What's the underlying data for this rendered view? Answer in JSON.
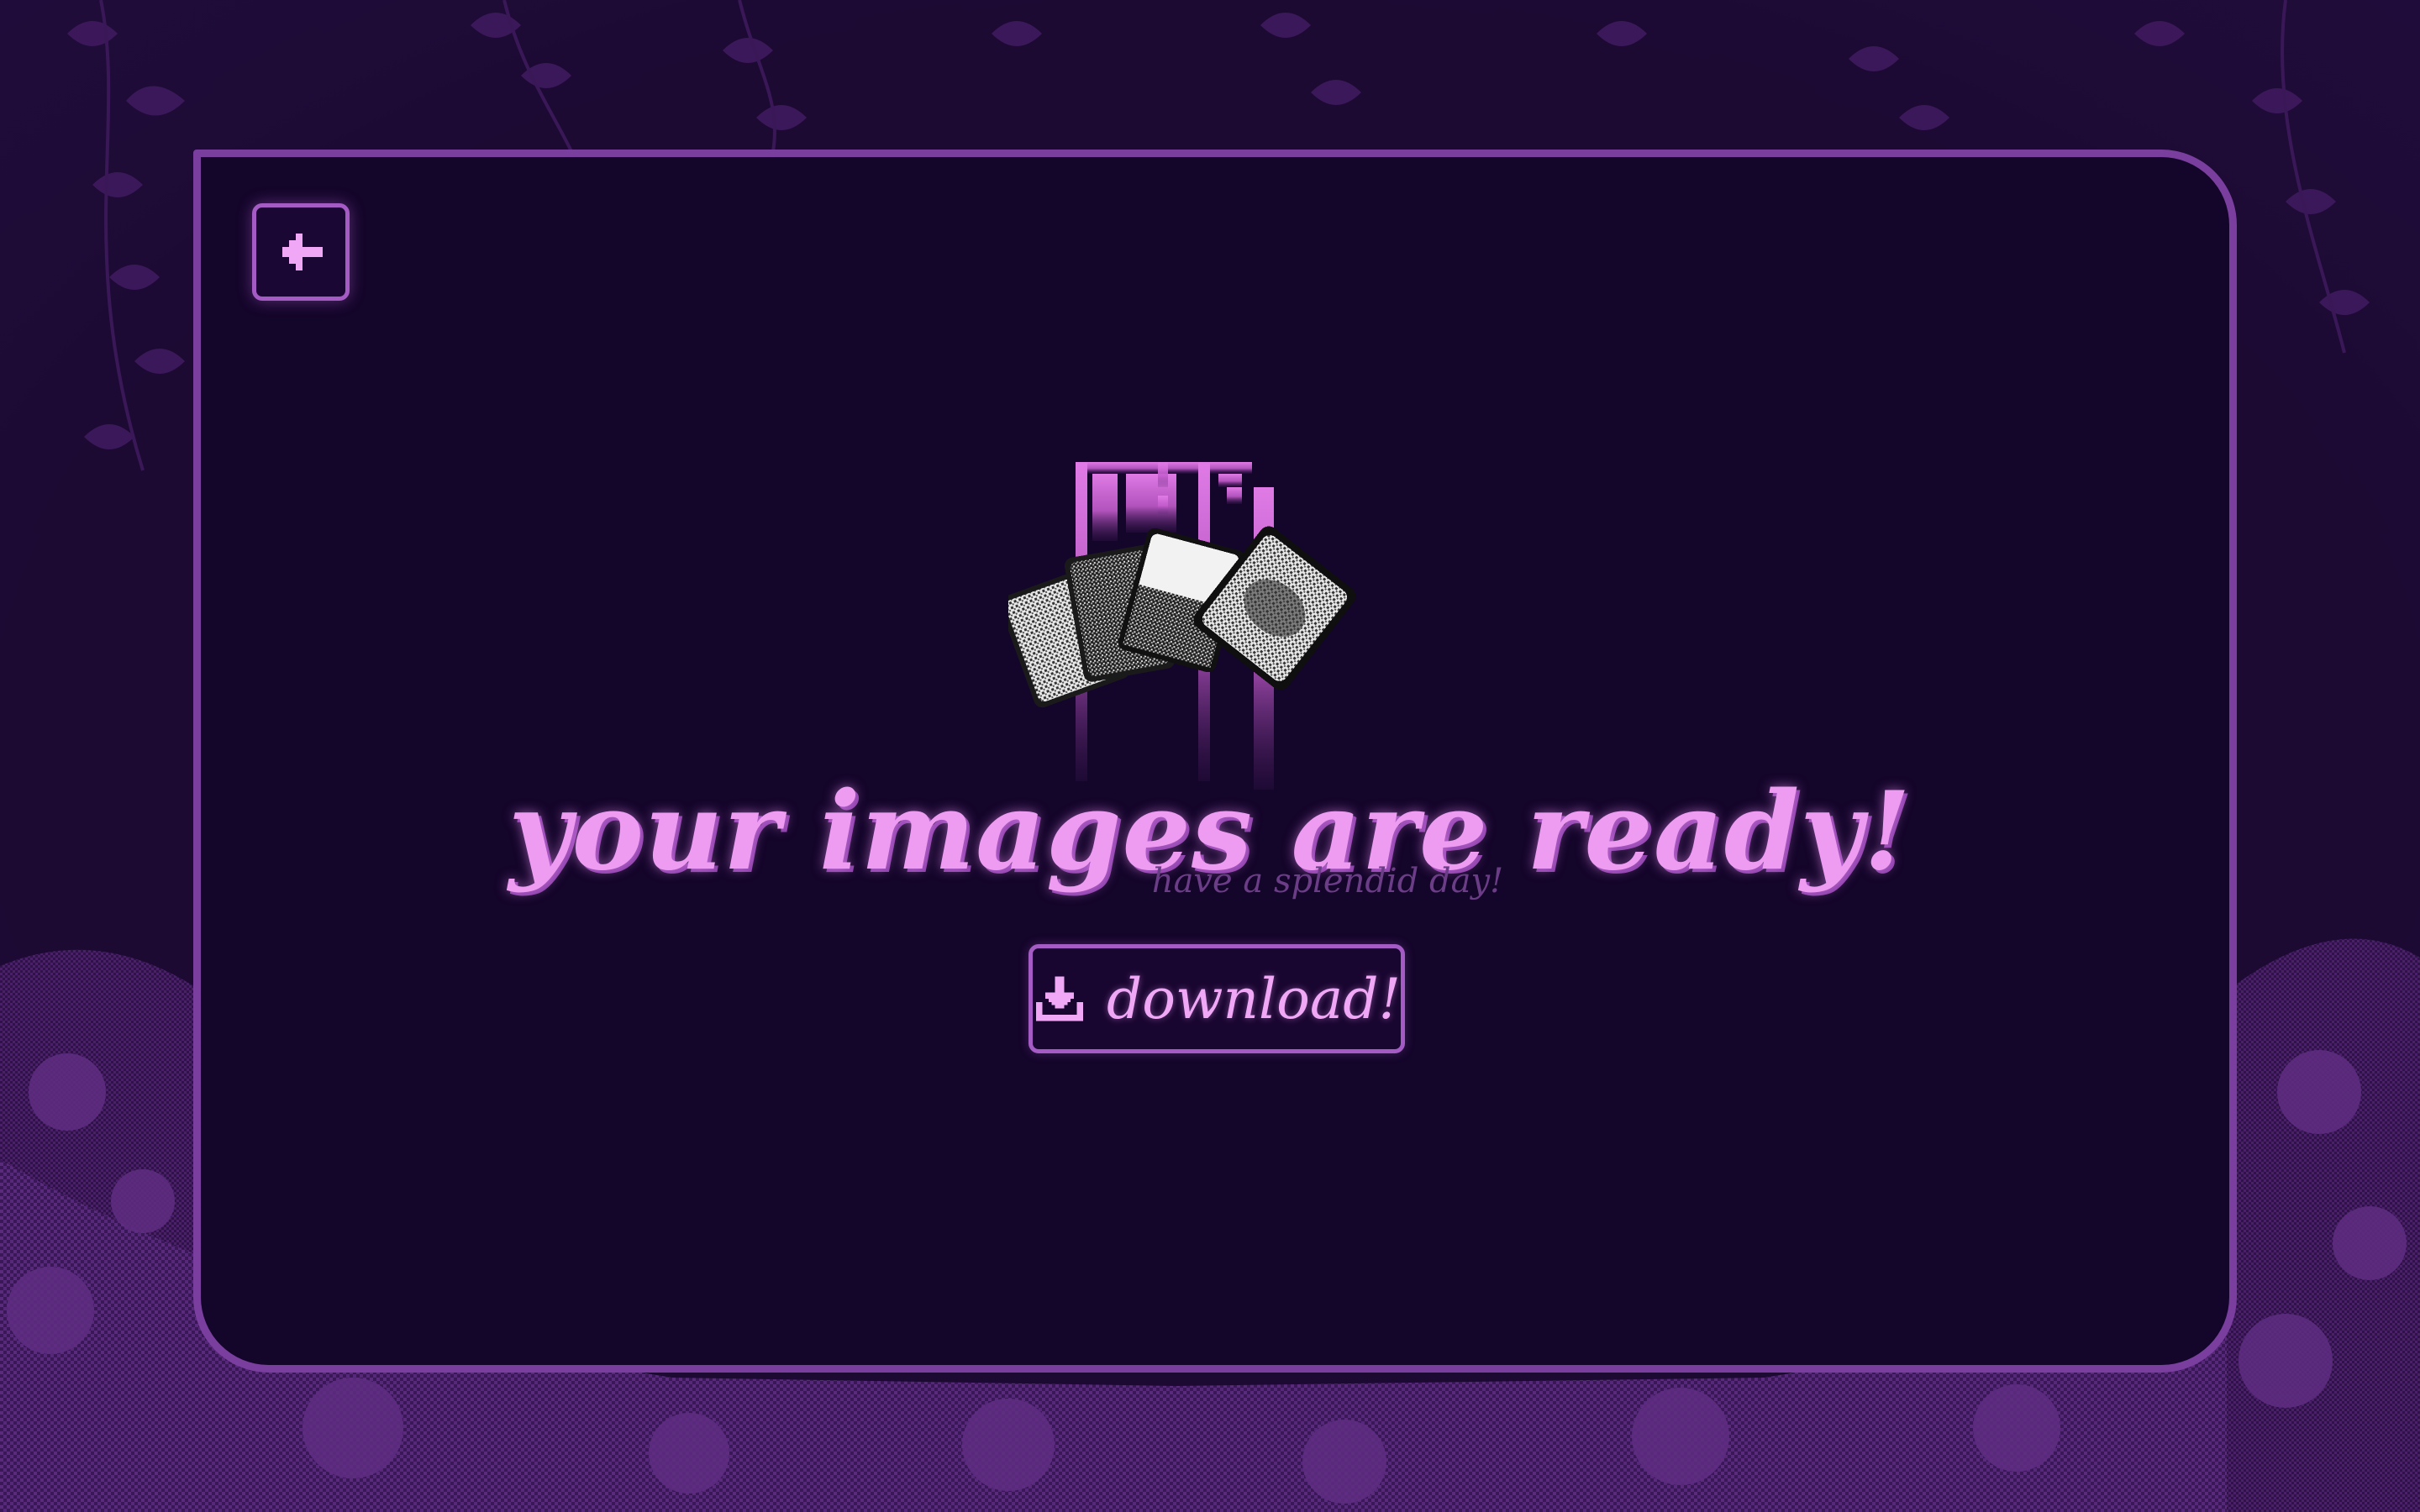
{
  "screen": {
    "title": "your images are ready!",
    "subtitle": "have a splendid day!",
    "download_label": "download!",
    "back_icon": "arrow-left-icon",
    "download_icon": "download-icon",
    "hero_icon": "floppy-disk-with-photos-icon"
  },
  "colors": {
    "background": "#1c0a33",
    "panel": "#14052a",
    "panel_border": "#7a3f9e",
    "accent": "#ee9cf2",
    "muted_text": "#6b3d86",
    "foliage": "#4a2168"
  }
}
